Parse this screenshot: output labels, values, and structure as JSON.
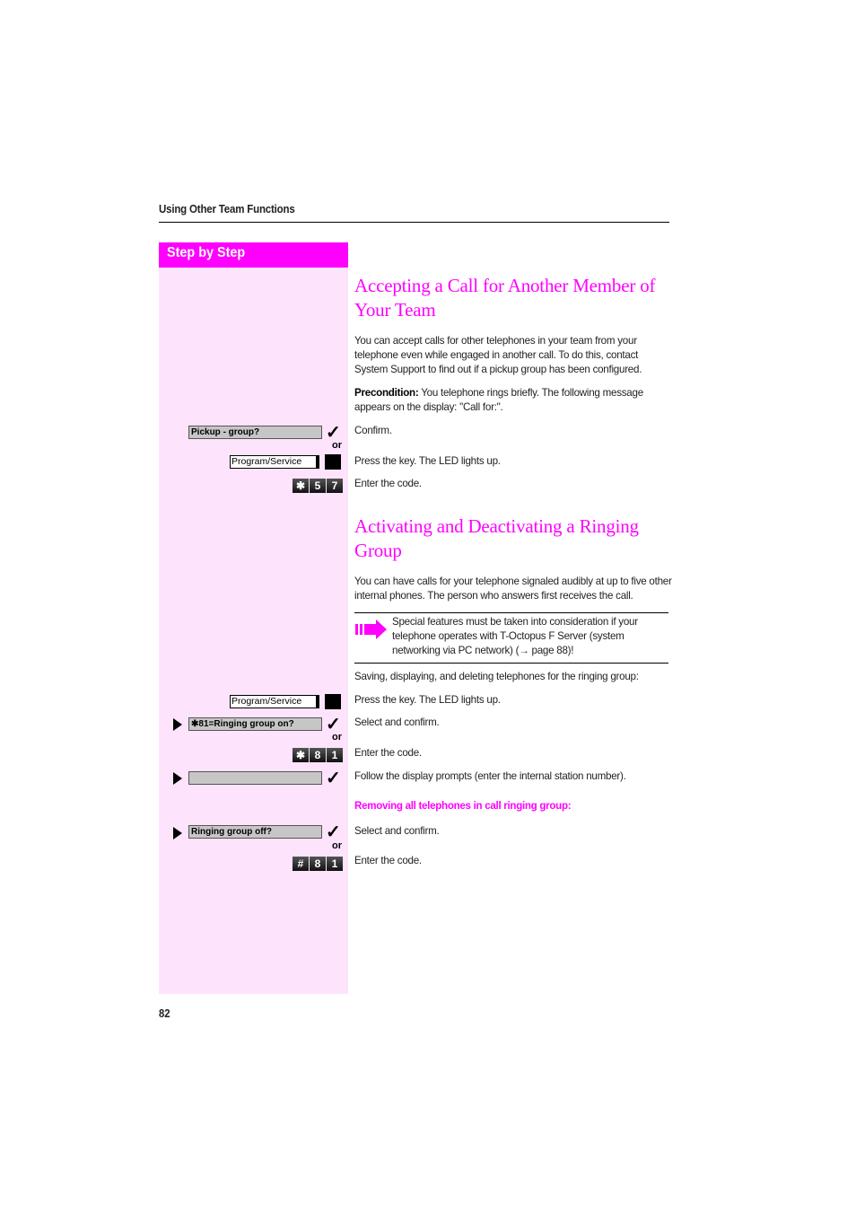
{
  "header": {
    "section_title": "Using Other Team Functions"
  },
  "sidebar": {
    "title": "Step by Step"
  },
  "section1": {
    "heading_line1": "Accepting a Call for Another Member of",
    "heading_line2": "Your Team",
    "intro": "You can accept calls for other telephones in your team from your telephone even while engaged in another call. To do this, contact System Support to find out if a pickup group has been configured.",
    "precondition_label": "Precondition:",
    "precondition_text": " You telephone rings briefly. The following message appears on the display: \"Call for:\".",
    "steps": [
      {
        "display": "Pickup - group?",
        "text": "Confirm.",
        "or": "or"
      },
      {
        "key_label": "Program/Service",
        "text": "Press the key. The LED lights up."
      },
      {
        "code": [
          "✱",
          "5",
          "7"
        ],
        "text": "Enter the code."
      }
    ]
  },
  "section2": {
    "heading_line1": "Activating and Deactivating a Ringing",
    "heading_line2": "Group",
    "intro": "You can have calls for your telephone signaled audibly at up to five other internal phones. The person who answers first receives the call.",
    "note": {
      "icon": "arrow-right-icon",
      "text": "Special features must be taken into consideration if your telephone operates with T-Octopus F Server (system networking via PC network) (→ page 88)!"
    },
    "saving_intro": "Saving, displaying, and deleting telephones for the ringing group:",
    "steps": [
      {
        "key_label": "Program/Service",
        "text": "Press the key. The LED lights up."
      },
      {
        "display": "✱81=Ringing group on?",
        "text": "Select and confirm.",
        "or": "or"
      },
      {
        "code": [
          "✱",
          "8",
          "1"
        ],
        "text": "Enter the code."
      },
      {
        "display": "",
        "text": "Follow the display prompts (enter the internal station number)."
      }
    ],
    "remove_heading": "Removing all telephones in call ringing group:",
    "remove_steps": [
      {
        "display": "Ringing group off?",
        "text": "Select and confirm.",
        "or": "or"
      },
      {
        "code": [
          "#",
          "8",
          "1"
        ],
        "text": "Enter the code."
      }
    ]
  },
  "footer": {
    "page_number": "82"
  }
}
